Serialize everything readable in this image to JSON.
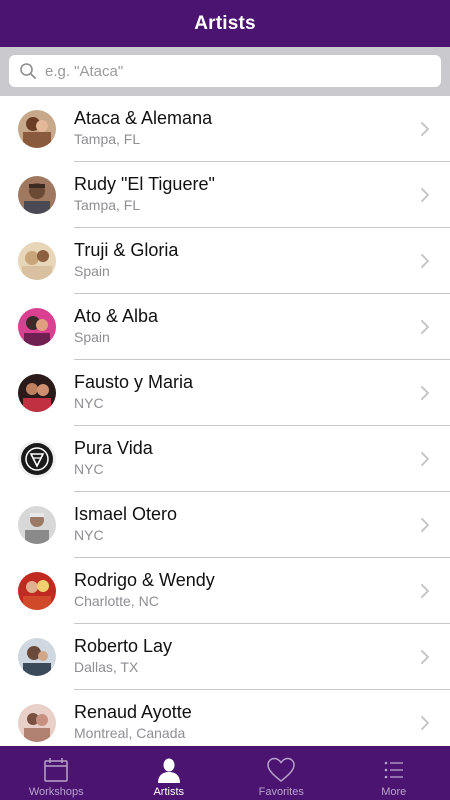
{
  "navbar": {
    "title": "Artists",
    "bg": "#4a1470"
  },
  "search": {
    "placeholder": "e.g. \"Ataca\"",
    "value": ""
  },
  "artists": [
    {
      "name": "Ataca & Alemana",
      "location": "Tampa, FL",
      "avatar_color": "#8a5a3c"
    },
    {
      "name": "Rudy \"El Tiguere\"",
      "location": "Tampa, FL",
      "avatar_color": "#6b4a35"
    },
    {
      "name": "Truji & Gloria",
      "location": "Spain",
      "avatar_color": "#c9a57a"
    },
    {
      "name": "Ato & Alba",
      "location": "Spain",
      "avatar_color": "#c0307a"
    },
    {
      "name": "Fausto y Maria",
      "location": "NYC",
      "avatar_color": "#3a2a2a"
    },
    {
      "name": "Pura Vida",
      "location": "NYC",
      "avatar_color": "#1a1a1a"
    },
    {
      "name": "Ismael Otero",
      "location": "NYC",
      "avatar_color": "#9a9a9a"
    },
    {
      "name": "Rodrigo & Wendy",
      "location": "Charlotte, NC",
      "avatar_color": "#d04a2a"
    },
    {
      "name": "Roberto Lay",
      "location": "Dallas, TX",
      "avatar_color": "#5a6a7a"
    },
    {
      "name": "Renaud Ayotte",
      "location": "Montreal, Canada",
      "avatar_color": "#b08070"
    }
  ],
  "tabbar": {
    "tabs": [
      {
        "label": "Workshops",
        "icon": "calendar-icon",
        "active": false
      },
      {
        "label": "Artists",
        "icon": "person-icon",
        "active": true
      },
      {
        "label": "Favorites",
        "icon": "heart-icon",
        "active": false
      },
      {
        "label": "More",
        "icon": "list-icon",
        "active": false
      }
    ]
  }
}
